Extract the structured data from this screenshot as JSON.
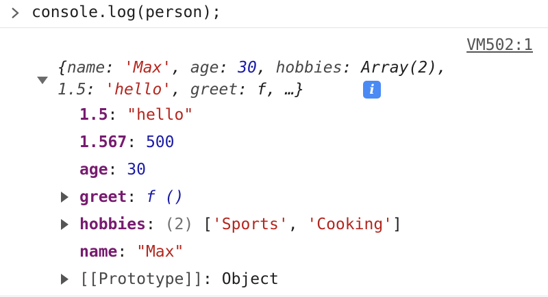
{
  "console": {
    "input": "console.log(person);",
    "source_link": "VM502:1",
    "summary": {
      "open_brace": "{",
      "name_key": "name",
      "name_val": "'Max'",
      "age_key": "age",
      "age_val": "30",
      "hobbies_key": "hobbies",
      "hobbies_val": "Array(2)",
      "k15_key": "1.5",
      "k15_val": "'hello'",
      "greet_key": "greet",
      "greet_val": "f",
      "ellipsis": "…}"
    },
    "props": [
      {
        "key": "1.5",
        "value": "\"hello\""
      },
      {
        "key": "1.567",
        "value": "500"
      },
      {
        "key": "age",
        "value": "30"
      },
      {
        "key": "greet",
        "value": "f ()"
      },
      {
        "key": "hobbies",
        "count": "(2)",
        "value_open": "[",
        "item1": "'Sports'",
        "item2": "'Cooking'",
        "value_close": "]"
      },
      {
        "key": "name",
        "value": "\"Max\""
      },
      {
        "key": "[[Prototype]]",
        "value": "Object"
      }
    ],
    "info_icon": "i"
  },
  "icons": {
    "prompt": "chevron-right-icon",
    "expand_open": "triangle-down-icon",
    "expand_closed": "triangle-right-icon",
    "info": "info-icon"
  },
  "colors": {
    "string": "#b3261e",
    "number": "#1a1aa6",
    "key": "#771b6f",
    "info_badge": "#4a8af4"
  }
}
